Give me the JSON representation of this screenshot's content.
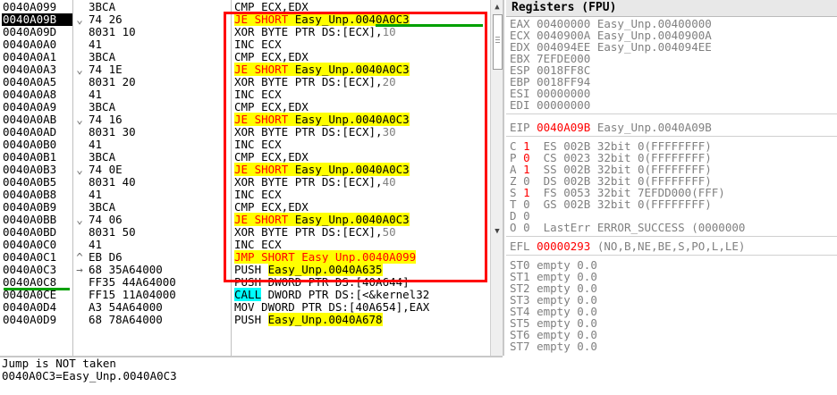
{
  "disassembly": {
    "rows": [
      {
        "addr": "0040A099",
        "marker": "",
        "hex": "3BCA",
        "instr": [
          {
            "t": "CMP ECX,EDX",
            "c": ""
          }
        ]
      },
      {
        "addr": "0040A09B",
        "marker": "⌄",
        "hex": "74 26",
        "sel": true,
        "instr": [
          {
            "t": "JE",
            "c": "op-j"
          },
          {
            "t": " SHORT ",
            "c": "op-j"
          },
          {
            "t": "Easy_Unp.0040A0C3",
            "c": "tgt-y"
          }
        ]
      },
      {
        "addr": "0040A09D",
        "marker": "",
        "hex": "8031 10",
        "instr": [
          {
            "t": "XOR BYTE PTR DS:[ECX],",
            "c": ""
          },
          {
            "t": "10",
            "c": "num"
          }
        ]
      },
      {
        "addr": "0040A0A0",
        "marker": "",
        "hex": "41",
        "instr": [
          {
            "t": "INC ECX",
            "c": ""
          }
        ]
      },
      {
        "addr": "0040A0A1",
        "marker": "",
        "hex": "3BCA",
        "instr": [
          {
            "t": "CMP ECX,EDX",
            "c": ""
          }
        ]
      },
      {
        "addr": "0040A0A3",
        "marker": "⌄",
        "hex": "74 1E",
        "instr": [
          {
            "t": "JE",
            "c": "op-j"
          },
          {
            "t": " SHORT ",
            "c": "op-j"
          },
          {
            "t": "Easy_Unp.0040A0C3",
            "c": "tgt-y"
          }
        ]
      },
      {
        "addr": "0040A0A5",
        "marker": "",
        "hex": "8031 20",
        "instr": [
          {
            "t": "XOR BYTE PTR DS:[ECX],",
            "c": ""
          },
          {
            "t": "20",
            "c": "num"
          }
        ]
      },
      {
        "addr": "0040A0A8",
        "marker": "",
        "hex": "41",
        "instr": [
          {
            "t": "INC ECX",
            "c": ""
          }
        ]
      },
      {
        "addr": "0040A0A9",
        "marker": "",
        "hex": "3BCA",
        "instr": [
          {
            "t": "CMP ECX,EDX",
            "c": ""
          }
        ]
      },
      {
        "addr": "0040A0AB",
        "marker": "⌄",
        "hex": "74 16",
        "instr": [
          {
            "t": "JE",
            "c": "op-j"
          },
          {
            "t": " SHORT ",
            "c": "op-j"
          },
          {
            "t": "Easy_Unp.0040A0C3",
            "c": "tgt-y"
          }
        ]
      },
      {
        "addr": "0040A0AD",
        "marker": "",
        "hex": "8031 30",
        "instr": [
          {
            "t": "XOR BYTE PTR DS:[ECX],",
            "c": ""
          },
          {
            "t": "30",
            "c": "num"
          }
        ]
      },
      {
        "addr": "0040A0B0",
        "marker": "",
        "hex": "41",
        "instr": [
          {
            "t": "INC ECX",
            "c": ""
          }
        ]
      },
      {
        "addr": "0040A0B1",
        "marker": "",
        "hex": "3BCA",
        "instr": [
          {
            "t": "CMP ECX,EDX",
            "c": ""
          }
        ]
      },
      {
        "addr": "0040A0B3",
        "marker": "⌄",
        "hex": "74 0E",
        "instr": [
          {
            "t": "JE",
            "c": "op-j"
          },
          {
            "t": " SHORT ",
            "c": "op-j"
          },
          {
            "t": "Easy_Unp.0040A0C3",
            "c": "tgt-y"
          }
        ]
      },
      {
        "addr": "0040A0B5",
        "marker": "",
        "hex": "8031 40",
        "instr": [
          {
            "t": "XOR BYTE PTR DS:[ECX],",
            "c": ""
          },
          {
            "t": "40",
            "c": "num"
          }
        ]
      },
      {
        "addr": "0040A0B8",
        "marker": "",
        "hex": "41",
        "instr": [
          {
            "t": "INC ECX",
            "c": ""
          }
        ]
      },
      {
        "addr": "0040A0B9",
        "marker": "",
        "hex": "3BCA",
        "instr": [
          {
            "t": "CMP ECX,EDX",
            "c": ""
          }
        ]
      },
      {
        "addr": "0040A0BB",
        "marker": "⌄",
        "hex": "74 06",
        "instr": [
          {
            "t": "JE",
            "c": "op-j"
          },
          {
            "t": " SHORT ",
            "c": "op-j"
          },
          {
            "t": "Easy_Unp.0040A0C3",
            "c": "tgt-y"
          }
        ]
      },
      {
        "addr": "0040A0BD",
        "marker": "",
        "hex": "8031 50",
        "instr": [
          {
            "t": "XOR BYTE PTR DS:[ECX],",
            "c": ""
          },
          {
            "t": "50",
            "c": "num"
          }
        ]
      },
      {
        "addr": "0040A0C0",
        "marker": "",
        "hex": "41",
        "instr": [
          {
            "t": "INC ECX",
            "c": ""
          }
        ]
      },
      {
        "addr": "0040A0C1",
        "marker": "^",
        "hex": "EB D6",
        "instr": [
          {
            "t": "JMP SHORT Easy_Unp.0040A099",
            "c": "op-j tgt-y"
          }
        ]
      },
      {
        "addr": "0040A0C3",
        "marker": "→",
        "hex": "68 35A64000",
        "ul": true,
        "instr": [
          {
            "t": "PUSH ",
            "c": ""
          },
          {
            "t": "Easy_Unp.0040A635",
            "c": "push-t"
          }
        ]
      },
      {
        "addr": "0040A0C8",
        "marker": "",
        "hex": "FF35 44A64000",
        "instr": [
          {
            "t": "PUSH DWORD PTR DS:[40A644]",
            "c": ""
          }
        ]
      },
      {
        "addr": "0040A0CE",
        "marker": "",
        "hex": "FF15 11A04000",
        "instr": [
          {
            "t": "CALL",
            "c": "op-call"
          },
          {
            "t": " DWORD PTR DS:[<&kernel32",
            "c": ""
          }
        ]
      },
      {
        "addr": "0040A0D4",
        "marker": "",
        "hex": "A3 54A64000",
        "instr": [
          {
            "t": "MOV DWORD PTR DS:[40A654],EAX",
            "c": ""
          }
        ]
      },
      {
        "addr": "0040A0D9",
        "marker": "",
        "hex": "68 78A64000",
        "instr": [
          {
            "t": "PUSH ",
            "c": ""
          },
          {
            "t": "Easy_Unp.0040A678",
            "c": "push-t"
          }
        ]
      }
    ]
  },
  "info": {
    "line1": "Jump is NOT taken",
    "line2": "0040A0C3=Easy_Unp.0040A0C3"
  },
  "registers": {
    "title": "Registers (FPU)",
    "gp": [
      {
        "name": "EAX",
        "val": "00400000",
        "note": "Easy_Unp.00400000"
      },
      {
        "name": "ECX",
        "val": "0040900A",
        "note": "Easy_Unp.0040900A"
      },
      {
        "name": "EDX",
        "val": "004094EE",
        "note": "Easy_Unp.004094EE"
      },
      {
        "name": "EBX",
        "val": "7EFDE000",
        "note": ""
      },
      {
        "name": "ESP",
        "val": "0018FF8C",
        "note": ""
      },
      {
        "name": "EBP",
        "val": "0018FF94",
        "note": ""
      },
      {
        "name": "ESI",
        "val": "00000000",
        "note": ""
      },
      {
        "name": "EDI",
        "val": "00000000",
        "note": ""
      }
    ],
    "eip": {
      "name": "EIP",
      "val": "0040A09B",
      "note": "Easy_Unp.0040A09B"
    },
    "flags": [
      {
        "f": "C",
        "v": "1",
        "red": true,
        "seg": "ES 002B 32bit 0(FFFFFFFF)"
      },
      {
        "f": "P",
        "v": "0",
        "red": true,
        "seg": "CS 0023 32bit 0(FFFFFFFF)"
      },
      {
        "f": "A",
        "v": "1",
        "red": true,
        "seg": "SS 002B 32bit 0(FFFFFFFF)"
      },
      {
        "f": "Z",
        "v": "0",
        "red": false,
        "seg": "DS 002B 32bit 0(FFFFFFFF)"
      },
      {
        "f": "S",
        "v": "1",
        "red": true,
        "seg": "FS 0053 32bit 7EFDD000(FFF)"
      },
      {
        "f": "T",
        "v": "0",
        "red": false,
        "seg": "GS 002B 32bit 0(FFFFFFFF)"
      },
      {
        "f": "D",
        "v": "0",
        "red": false,
        "seg": ""
      },
      {
        "f": "O",
        "v": "0",
        "red": false,
        "seg": "LastErr ERROR_SUCCESS (0000000"
      }
    ],
    "efl": {
      "name": "EFL",
      "val": "00000293",
      "note": "(NO,B,NE,BE,S,PO,L,LE)"
    },
    "fpu": [
      {
        "name": "ST0",
        "val": "empty 0.0"
      },
      {
        "name": "ST1",
        "val": "empty 0.0"
      },
      {
        "name": "ST2",
        "val": "empty 0.0"
      },
      {
        "name": "ST3",
        "val": "empty 0.0"
      },
      {
        "name": "ST4",
        "val": "empty 0.0"
      },
      {
        "name": "ST5",
        "val": "empty 0.0"
      },
      {
        "name": "ST6",
        "val": "empty 0.0"
      },
      {
        "name": "ST7",
        "val": "empty 0.0"
      }
    ]
  },
  "colors": {
    "highlight_box": "#ff0000",
    "underline": "#00a000",
    "jump": "#ffff00",
    "call": "#00ffff"
  },
  "icons": {
    "scroll_up": "triangle-up-icon",
    "scroll_down": "triangle-down-icon"
  }
}
